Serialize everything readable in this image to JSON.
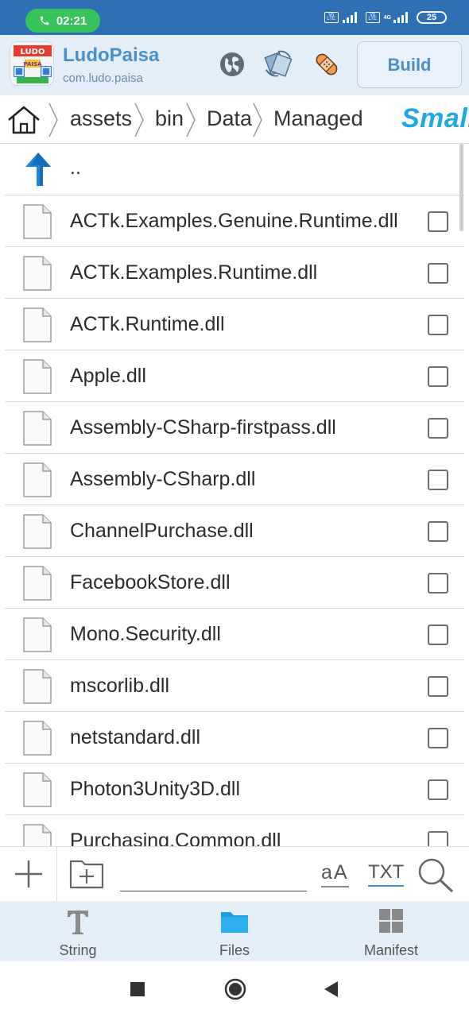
{
  "status_bar": {
    "time": "02:21",
    "battery": "25",
    "network": "4G"
  },
  "app": {
    "name": "LudoPaisa",
    "package": "com.ludo.paisa",
    "logo_text_top": "LUDO",
    "logo_text_bottom": "PAISA",
    "build_label": "Build",
    "colors": {
      "accent": "#4a90c8",
      "statusbar": "#2f6fb6",
      "header_bg": "#e4eef9",
      "call_pill": "#35c35a",
      "smali": "#1fa8e4"
    }
  },
  "header_icons": [
    "globe-icon",
    "sync-transfer-icon",
    "patch-icon"
  ],
  "breadcrumb": {
    "items": [
      "assets",
      "bin",
      "Data",
      "Managed"
    ],
    "mode_label": "Smali"
  },
  "file_list": {
    "parent_label": "..",
    "files": [
      {
        "name": "ACTk.Examples.Genuine.Runtime.dll",
        "checked": false
      },
      {
        "name": "ACTk.Examples.Runtime.dll",
        "checked": false
      },
      {
        "name": "ACTk.Runtime.dll",
        "checked": false
      },
      {
        "name": "Apple.dll",
        "checked": false
      },
      {
        "name": "Assembly-CSharp-firstpass.dll",
        "checked": false
      },
      {
        "name": "Assembly-CSharp.dll",
        "checked": false
      },
      {
        "name": "ChannelPurchase.dll",
        "checked": false
      },
      {
        "name": "FacebookStore.dll",
        "checked": false
      },
      {
        "name": "Mono.Security.dll",
        "checked": false
      },
      {
        "name": "mscorlib.dll",
        "checked": false
      },
      {
        "name": "netstandard.dll",
        "checked": false
      },
      {
        "name": "Photon3Unity3D.dll",
        "checked": false
      },
      {
        "name": "Purchasing.Common.dll",
        "checked": false
      }
    ]
  },
  "toolbar": {
    "search_value": "",
    "case_label": "aA",
    "txt_label": "TXT"
  },
  "bottom_nav": {
    "items": [
      {
        "label": "String",
        "icon": "text-icon"
      },
      {
        "label": "Files",
        "icon": "folder-icon",
        "active": true
      },
      {
        "label": "Manifest",
        "icon": "grid-icon"
      }
    ]
  }
}
